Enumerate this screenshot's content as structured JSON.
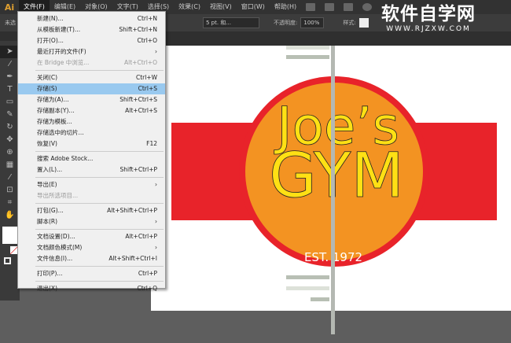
{
  "app": {
    "logo": "Ai"
  },
  "menubar": [
    "文件(F)",
    "编辑(E)",
    "对象(O)",
    "文字(T)",
    "选择(S)",
    "效果(C)",
    "视图(V)",
    "窗口(W)",
    "帮助(H)"
  ],
  "control": {
    "selection": "未选",
    "stroke_profile": "5 pt. 和...",
    "opacity_label": "不透明度:",
    "opacity": "100%",
    "style_label": "样式:"
  },
  "watermark": {
    "title": "软件自学网",
    "url": "WWW.RJZXW.COM"
  },
  "file_menu": [
    [
      {
        "label": "新建(N)...",
        "shortcut": "Ctrl+N"
      },
      {
        "label": "从模板新建(T)...",
        "shortcut": "Shift+Ctrl+N"
      },
      {
        "label": "打开(O)...",
        "shortcut": "Ctrl+O"
      },
      {
        "label": "最近打开的文件(F)",
        "shortcut": "›"
      },
      {
        "label": "在 Bridge 中浏览...",
        "shortcut": "Alt+Ctrl+O",
        "disabled": true
      }
    ],
    [
      {
        "label": "关闭(C)",
        "shortcut": "Ctrl+W"
      },
      {
        "label": "存储(S)",
        "shortcut": "Ctrl+S",
        "highlighted": true
      },
      {
        "label": "存储为(A)...",
        "shortcut": "Shift+Ctrl+S"
      },
      {
        "label": "存储副本(Y)...",
        "shortcut": "Alt+Ctrl+S"
      },
      {
        "label": "存储为模板...",
        "shortcut": ""
      },
      {
        "label": "存储选中的切片...",
        "shortcut": ""
      },
      {
        "label": "恢复(V)",
        "shortcut": "F12"
      }
    ],
    [
      {
        "label": "搜索 Adobe Stock...",
        "shortcut": ""
      },
      {
        "label": "置入(L)...",
        "shortcut": "Shift+Ctrl+P"
      }
    ],
    [
      {
        "label": "导出(E)",
        "shortcut": "›"
      },
      {
        "label": "导出所选项目...",
        "shortcut": "",
        "disabled": true
      }
    ],
    [
      {
        "label": "打包(G)...",
        "shortcut": "Alt+Shift+Ctrl+P"
      },
      {
        "label": "脚本(R)",
        "shortcut": "›"
      }
    ],
    [
      {
        "label": "文档设置(D)...",
        "shortcut": "Alt+Ctrl+P"
      },
      {
        "label": "文档颜色模式(M)",
        "shortcut": "›"
      },
      {
        "label": "文件信息(I)...",
        "shortcut": "Alt+Shift+Ctrl+I"
      }
    ],
    [
      {
        "label": "打印(P)...",
        "shortcut": "Ctrl+P"
      }
    ],
    [
      {
        "label": "退出(X)",
        "shortcut": "Ctrl+Q"
      }
    ]
  ],
  "artwork": {
    "line1": "Joe’s",
    "line2": "GYM",
    "est": "EST. 1972",
    "colors": {
      "red": "#e8232a",
      "orange": "#f39322",
      "yellow": "#ffe014"
    }
  }
}
